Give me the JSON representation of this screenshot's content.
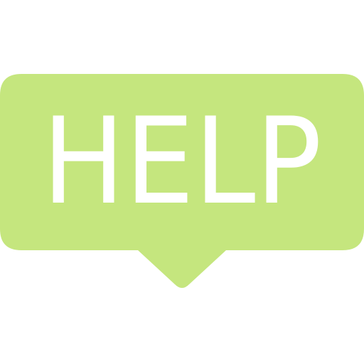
{
  "icon": {
    "name": "help-speech-bubble-icon",
    "label": "HELP",
    "colors": {
      "bubble": "#c5e67e",
      "text": "#ffffff",
      "background": "#ffffff"
    }
  }
}
